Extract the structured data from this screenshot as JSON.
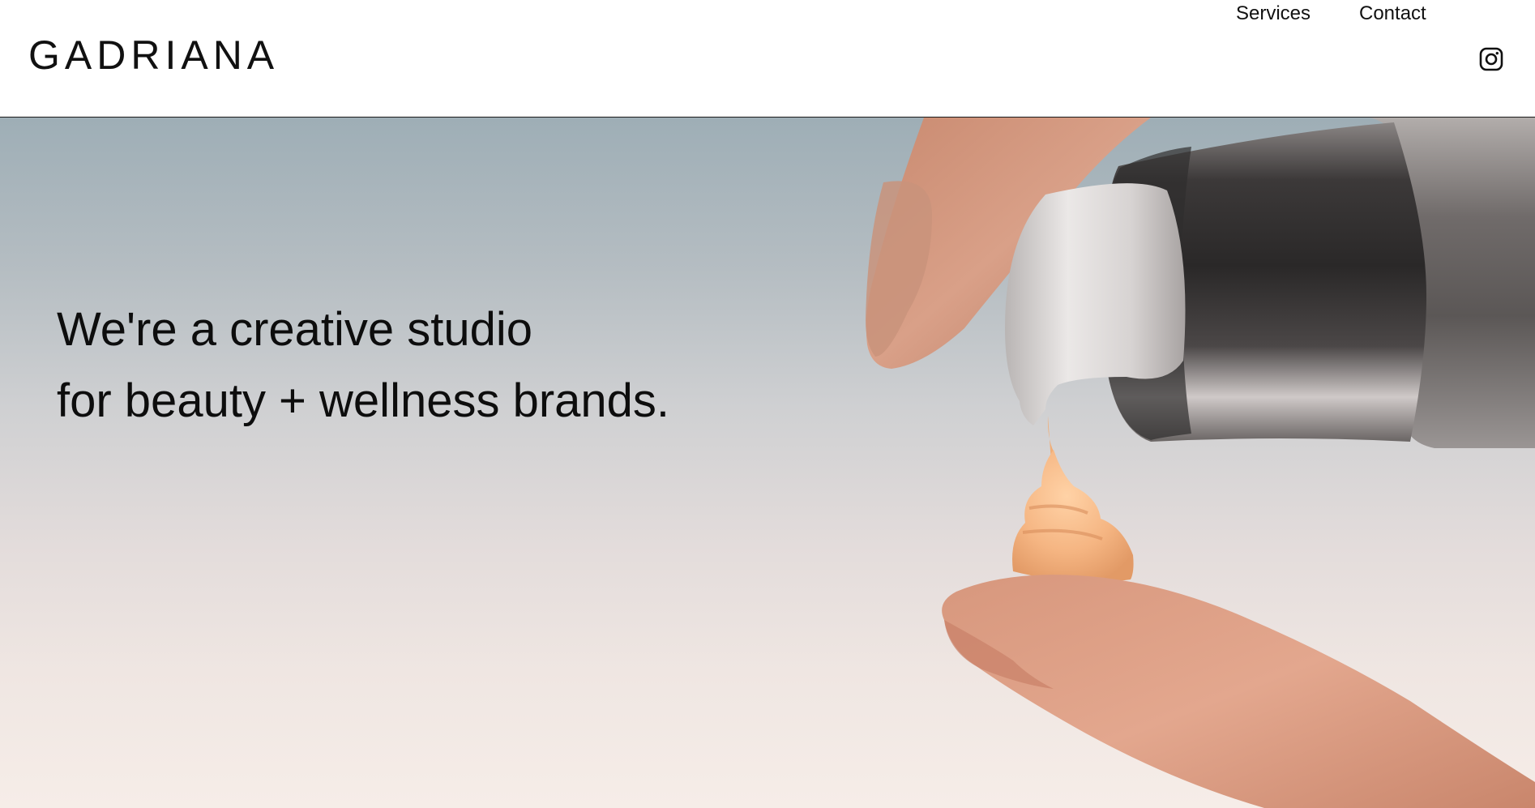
{
  "header": {
    "logo": "GADRIANA",
    "nav": {
      "services": "Services",
      "contact": "Contact"
    },
    "social_icon": "instagram-icon"
  },
  "hero": {
    "headline_line1": "We're a creative studio",
    "headline_line2": "for beauty + wellness brands.",
    "image_description_icon": "hero-photo",
    "colors": {
      "sky_top": "#9eaeb6",
      "sky_bottom": "#f6ede8",
      "skin": "#d99a80",
      "cream": "#f3b47f",
      "metal": "#5e5a59"
    }
  }
}
